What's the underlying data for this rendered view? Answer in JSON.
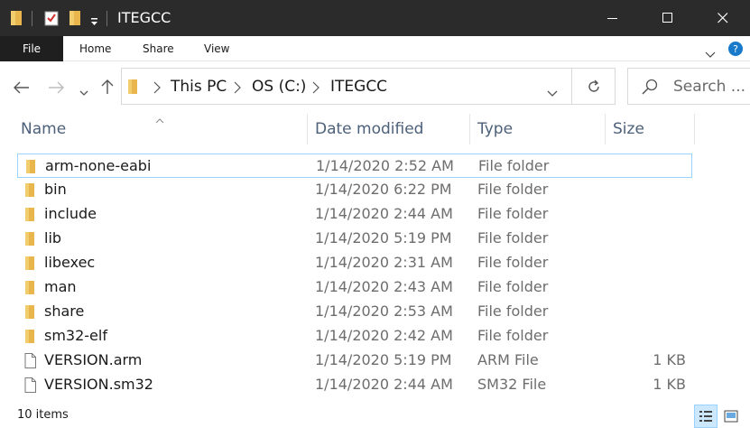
{
  "window": {
    "title": "ITEGCC",
    "controls": [
      "minimize",
      "maximize",
      "close"
    ]
  },
  "ribbon": {
    "file_label": "File",
    "tabs": [
      "Home",
      "Share",
      "View"
    ]
  },
  "address": {
    "crumbs": [
      "This PC",
      "OS (C:)",
      "ITEGCC"
    ]
  },
  "search": {
    "placeholder": "Search ..."
  },
  "columns": {
    "name": "Name",
    "date": "Date modified",
    "type": "Type",
    "size": "Size"
  },
  "files": [
    {
      "name": "arm-none-eabi",
      "date": "1/14/2020 2:52 AM",
      "type": "File folder",
      "size": "",
      "icon": "folder-icon",
      "selected": true
    },
    {
      "name": "bin",
      "date": "1/14/2020 6:22 PM",
      "type": "File folder",
      "size": "",
      "icon": "folder-icon"
    },
    {
      "name": "include",
      "date": "1/14/2020 2:44 AM",
      "type": "File folder",
      "size": "",
      "icon": "folder-icon"
    },
    {
      "name": "lib",
      "date": "1/14/2020 5:19 PM",
      "type": "File folder",
      "size": "",
      "icon": "folder-icon"
    },
    {
      "name": "libexec",
      "date": "1/14/2020 2:31 AM",
      "type": "File folder",
      "size": "",
      "icon": "folder-icon"
    },
    {
      "name": "man",
      "date": "1/14/2020 2:43 AM",
      "type": "File folder",
      "size": "",
      "icon": "folder-icon"
    },
    {
      "name": "share",
      "date": "1/14/2020 2:53 AM",
      "type": "File folder",
      "size": "",
      "icon": "folder-icon"
    },
    {
      "name": "sm32-elf",
      "date": "1/14/2020 2:42 AM",
      "type": "File folder",
      "size": "",
      "icon": "folder-icon"
    },
    {
      "name": "VERSION.arm",
      "date": "1/14/2020 5:19 PM",
      "type": "ARM File",
      "size": "1 KB",
      "icon": "file-icon"
    },
    {
      "name": "VERSION.sm32",
      "date": "1/14/2020 2:44 AM",
      "type": "SM32 File",
      "size": "1 KB",
      "icon": "file-icon"
    }
  ],
  "status": {
    "item_count": "10 items"
  },
  "colors": {
    "titlebar": "#2b2b2b",
    "selection_border": "#99d1ff",
    "folder": "#e8b64c",
    "header_text": "#4c607a"
  }
}
